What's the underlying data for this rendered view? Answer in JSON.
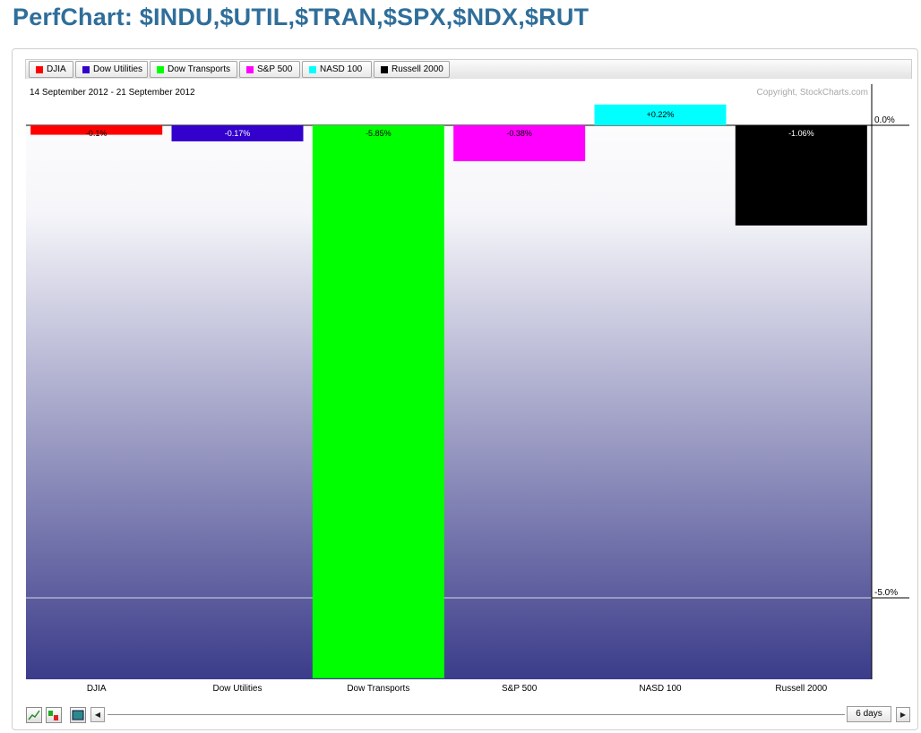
{
  "page": {
    "title": "PerfChart: $INDU,$UTIL,$TRAN,$SPX,$NDX,$RUT"
  },
  "chart_data": {
    "type": "bar",
    "date_range": "14 September 2012 - 21 September 2012",
    "copyright": "Copyright, StockCharts.com",
    "categories": [
      "DJIA",
      "Dow Utilities",
      "Dow Transports",
      "S&P 500",
      "NASD 100",
      "Russell 2000"
    ],
    "values": [
      -0.1,
      -0.17,
      -5.85,
      -0.38,
      0.22,
      -1.06
    ],
    "value_labels": [
      "-0.1%",
      "-0.17%",
      "-5.85%",
      "-0.38%",
      "+0.22%",
      "-1.06%"
    ],
    "colors": [
      "#ff0000",
      "#3300cc",
      "#00ff00",
      "#ff00ff",
      "#00ffff",
      "#000000"
    ],
    "y_ticks": [
      0,
      -5
    ],
    "y_tick_labels": [
      "0.0%",
      "-5.0%"
    ],
    "ylim": [
      -5.85,
      0.25
    ],
    "y_axis_side": "right",
    "grid": true,
    "background": "vertical gradient white to navy",
    "legend": [
      {
        "label": "DJIA",
        "color": "#ff0000"
      },
      {
        "label": "Dow Utilities",
        "color": "#3300cc"
      },
      {
        "label": "Dow Transports",
        "color": "#00ff00"
      },
      {
        "label": "S&P 500",
        "color": "#ff00ff"
      },
      {
        "label": "NASD 100",
        "color": "#00ffff"
      },
      {
        "label": "Russell 2000",
        "color": "#000000"
      }
    ],
    "legend_placement": "top"
  },
  "controls": {
    "period_label": "6 days",
    "tools": [
      "line-chart-icon",
      "histogram-icon",
      "bar-chart-icon"
    ],
    "scroll_left": "◀",
    "scroll_right": "▶"
  }
}
